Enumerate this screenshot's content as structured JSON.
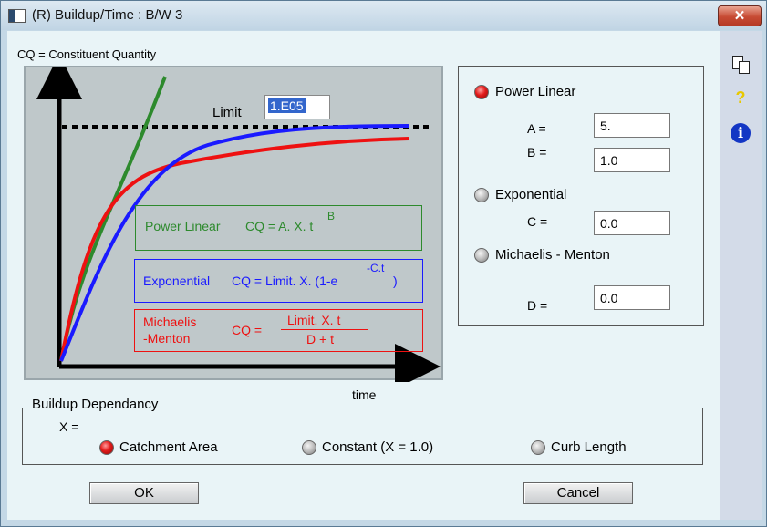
{
  "window": {
    "title": "(R) Buildup/Time : B/W 3",
    "close_glyph": "✕"
  },
  "sidebar": {
    "copy_icon": "copy-icon",
    "help_glyph": "?",
    "info_glyph": "i"
  },
  "cq_legend": "CQ = Constituent Quantity",
  "chart": {
    "limit_label": "Limit",
    "limit_value": "1.E05",
    "x_axis_label": "time",
    "colors": {
      "power_linear": "#2d8a2d",
      "exponential": "#1a1aff",
      "michaelis": "#ee1111"
    },
    "formulas": {
      "power_linear_name": "Power Linear",
      "power_linear_eq": "CQ = A. X. t",
      "power_linear_sup": "B",
      "exponential_name": "Exponential",
      "exponential_eq_a": "CQ = Limit. X. (1-e",
      "exponential_sup": "-C.t",
      "exponential_eq_b": ")",
      "michaelis_name_1": "Michaelis",
      "michaelis_name_2": "-Menton",
      "michaelis_eq": "CQ =",
      "michaelis_num": "Limit. X. t",
      "michaelis_den": "D + t"
    }
  },
  "params": {
    "power_linear": {
      "label": "Power Linear",
      "selected": true
    },
    "a": {
      "label": "A =",
      "value": "5."
    },
    "b": {
      "label": "B =",
      "value": "1.0"
    },
    "exponential": {
      "label": "Exponential",
      "selected": false
    },
    "c": {
      "label": "C =",
      "value": "0.0"
    },
    "michaelis": {
      "label": "Michaelis - Menton",
      "selected": false
    },
    "d": {
      "label": "D =",
      "value": "0.0"
    }
  },
  "buildup": {
    "title": "Buildup Dependancy",
    "x_label": "X =",
    "options": [
      {
        "label": "Catchment Area",
        "selected": true
      },
      {
        "label": "Constant (X = 1.0)",
        "selected": false
      },
      {
        "label": "Curb Length",
        "selected": false
      }
    ]
  },
  "buttons": {
    "ok": "OK",
    "cancel": "Cancel"
  }
}
